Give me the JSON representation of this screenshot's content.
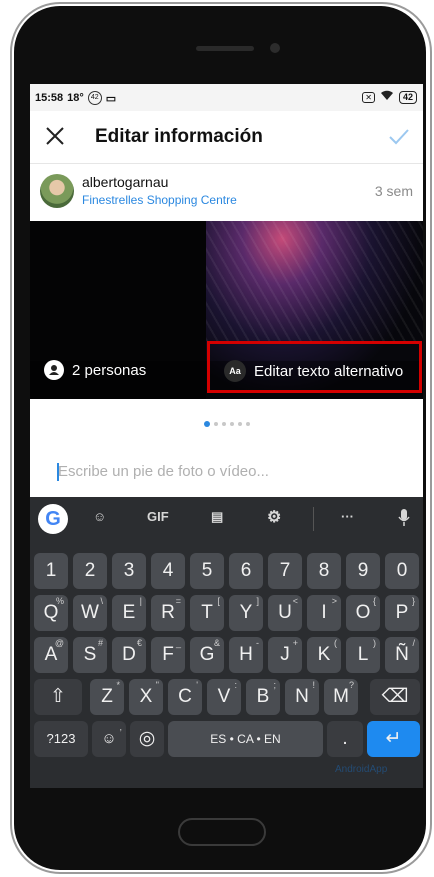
{
  "status_bar": {
    "time": "15:58",
    "temp": "18°",
    "notif_badge": "42",
    "battery": "42"
  },
  "topbar": {
    "title": "Editar información"
  },
  "post": {
    "username": "albertogarnau",
    "location": "Finestrelles Shopping Centre",
    "time_ago": "3 sem"
  },
  "photo": {
    "tag_people_label": "2 personas",
    "alt_text_label": "Editar texto alternativo",
    "alt_icon_label": "Aa",
    "carousel_count": 6,
    "carousel_active": 0
  },
  "caption": {
    "placeholder": "Escribe un pie de foto o vídeo..."
  },
  "keyboard": {
    "toolbar": {
      "gif": "GIF",
      "more": "···"
    },
    "rows": [
      [
        "1",
        "2",
        "3",
        "4",
        "5",
        "6",
        "7",
        "8",
        "9",
        "0"
      ],
      [
        "Q",
        "W",
        "E",
        "R",
        "T",
        "Y",
        "U",
        "I",
        "O",
        "P"
      ],
      [
        "A",
        "S",
        "D",
        "F",
        "G",
        "H",
        "J",
        "K",
        "L",
        "Ñ"
      ],
      [
        "Z",
        "X",
        "C",
        "V",
        "B",
        "N",
        "M"
      ]
    ],
    "row_hints": [
      [],
      [
        "%",
        "\\",
        "|",
        "=",
        "[",
        "]",
        "<",
        ">",
        "{",
        "}"
      ],
      [
        "@",
        "#",
        "€",
        "_",
        "&",
        "-",
        "+",
        "(",
        ")",
        "/"
      ],
      [
        "*",
        "\"",
        "'",
        ":",
        ";",
        "!",
        "?"
      ]
    ],
    "symbols_key": "?123",
    "emoji_sub": ",",
    "space_label": "ES • CA • EN",
    "period_key": "."
  },
  "watermark": "AndroidApp",
  "colors": {
    "accent": "#2b88e0",
    "highlight_box": "#d40000",
    "keyboard_bg": "#2b2d30"
  }
}
